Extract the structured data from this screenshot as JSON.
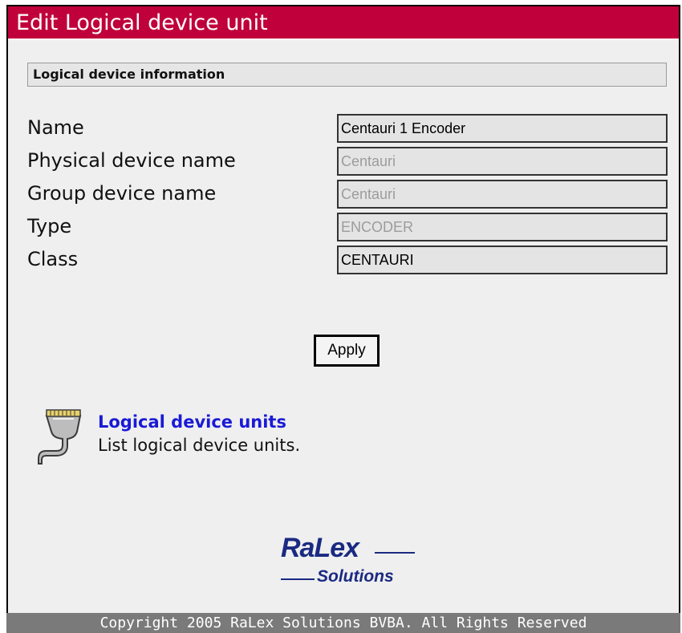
{
  "window": {
    "title": "Edit Logical device unit"
  },
  "section": {
    "header": "Logical device information"
  },
  "form": {
    "fields": [
      {
        "label": "Name",
        "value": "Centauri 1 Encoder",
        "disabled": false
      },
      {
        "label": "Physical device name",
        "value": "Centauri",
        "disabled": true
      },
      {
        "label": "Group device name",
        "value": "Centauri",
        "disabled": true
      },
      {
        "label": "Type",
        "value": "ENCODER",
        "disabled": true
      },
      {
        "label": "Class",
        "value": "CENTAURI",
        "disabled": false
      }
    ],
    "apply_label": "Apply"
  },
  "link": {
    "icon": "serial-port-cable-icon",
    "title": "Logical device units",
    "description": "List logical device units."
  },
  "logo": {
    "line1": "RaLex",
    "line2": "Solutions"
  },
  "footer": {
    "copyright": "Copyright 2005 RaLex Solutions BVBA. All Rights Reserved"
  },
  "colors": {
    "titlebar": "#c0003a",
    "background": "#efefef",
    "link": "#1a1ad6",
    "logo": "#1a2a82",
    "footer": "#7a7a7a"
  }
}
